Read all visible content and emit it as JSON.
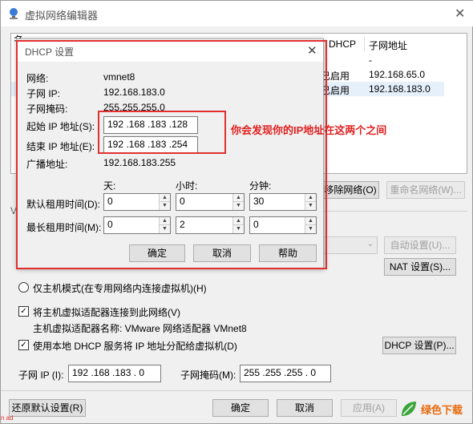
{
  "window": {
    "title": "虚拟网络编辑器",
    "close_glyph": "✕",
    "app_icon": "network-globe-icon"
  },
  "table": {
    "headers": [
      "名",
      "DHCP",
      "子网地址"
    ],
    "rows": [
      {
        "dhcp": "",
        "subnet": "-"
      },
      {
        "dhcp": "已启用",
        "subnet": "192.168.65.0"
      },
      {
        "dhcp": "已启用",
        "subnet": "192.168.183.0"
      }
    ]
  },
  "bg_buttons": {
    "remove_network": "移除网络(O)",
    "rename_network": "重命名网络(W)...",
    "auto_settings": "自动设置(U)...",
    "nat_settings": "NAT 设置(S)...",
    "dhcp_settings": "DHCP 设置(P)..."
  },
  "options": {
    "host_only": "仅主机模式(在专用网络内连接虚拟机)(H)",
    "connect_adapter": "将主机虚拟适配器连接到此网络(V)",
    "adapter_name": "主机虚拟适配器名称: VMware 网络适配器 VMnet8",
    "use_dhcp": "使用本地 DHCP 服务将 IP 地址分配给虚拟机(D)",
    "check_mark": "✓"
  },
  "subnet": {
    "ip_label": "子网 IP (I):",
    "ip_value": "192 .168 .183 .  0",
    "mask_label": "子网掩码(M):",
    "mask_value": "255 .255 .255 .  0"
  },
  "footer": {
    "restore": "还原默认设置(R)",
    "ok": "确定",
    "cancel": "取消",
    "apply": "应用(A)"
  },
  "dialog": {
    "title": "DHCP 设置",
    "close_glyph": "✕",
    "network_label": "网络:",
    "network_value": "vmnet8",
    "subnet_ip_label": "子网 IP:",
    "subnet_ip_value": "192.168.183.0",
    "subnet_mask_label": "子网掩码:",
    "subnet_mask_value": "255.255.255.0",
    "start_ip_label": "起始 IP 地址(S):",
    "start_ip_value": "192 .168 .183 .128",
    "end_ip_label": "结束 IP 地址(E):",
    "end_ip_value": "192 .168 .183 .254",
    "broadcast_label": "广播地址:",
    "broadcast_value": "192.168.183.255",
    "days_header": "天:",
    "hours_header": "小时:",
    "minutes_header": "分钟:",
    "default_lease_label": "默认租用时间(D):",
    "default_lease": [
      "0",
      "0",
      "30"
    ],
    "max_lease_label": "最长租用时间(M):",
    "max_lease": [
      "0",
      "2",
      "0"
    ],
    "ok": "确定",
    "cancel": "取消",
    "help": "帮助",
    "spin_up": "▲",
    "spin_down": "▼"
  },
  "annotation": {
    "text": "你会发现你的IP地址在这两个之间",
    "color": "#e02020"
  },
  "watermark": {
    "brand": "绿色下载",
    "left_fragment": "n ad"
  },
  "colors": {
    "annotation_red": "#e03030",
    "selected_row": "#e5f0fb"
  }
}
